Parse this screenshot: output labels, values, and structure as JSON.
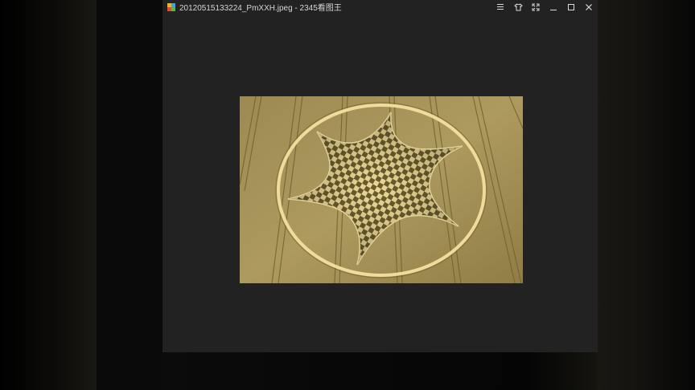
{
  "window": {
    "title": "20120515133224_PmXXH.jpeg - 2345看图王",
    "app_icon": "2345-picture-viewer-icon",
    "controls": [
      "menu-icon",
      "skin-icon",
      "fullscreen-icon",
      "minimize-icon",
      "maximize-icon",
      "close-icon"
    ]
  },
  "image": {
    "subject": "crop-circle-six-pointed-star",
    "colors": {
      "field": "#a89458",
      "field_dark": "#7f6f3c",
      "flattened": "#e6d28e",
      "shadow": "#5c4f28",
      "viewer_bg": "#222222"
    }
  }
}
